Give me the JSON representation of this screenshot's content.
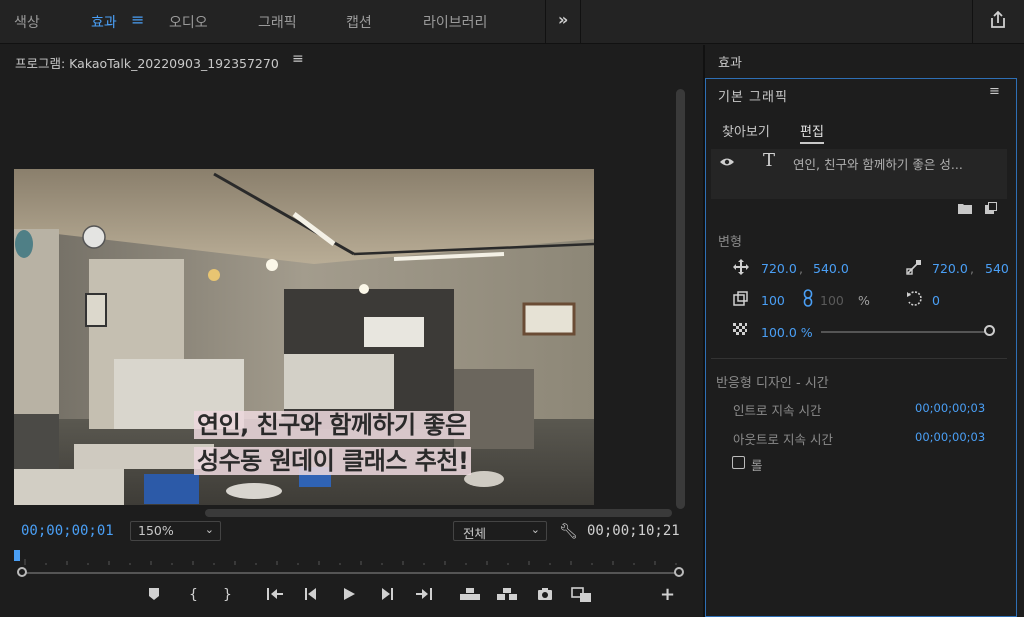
{
  "workspaces": {
    "tabs": [
      {
        "label": "색상",
        "active": false
      },
      {
        "label": "효과",
        "active": true
      },
      {
        "label": "오디오",
        "active": false
      },
      {
        "label": "그래픽",
        "active": false
      },
      {
        "label": "캡션",
        "active": false
      },
      {
        "label": "라이브러리",
        "active": false
      }
    ],
    "menu_glyph": "≡",
    "more_glyph": "»"
  },
  "program": {
    "title": "프로그램: KakaoTalk_20220903_192357270",
    "menu_glyph": "≡",
    "caption_line1": "연인, 친구와 함께하기 좋은",
    "caption_line2": "성수동 원데이 클래스 추천!",
    "timecode_current": "00;00;00;01",
    "zoom": "150%",
    "quality": "전체",
    "timecode_duration": "00;00;10;21",
    "playhead_fraction": 0.0
  },
  "effects_panel": {
    "tab_label": "효과"
  },
  "essential_graphics": {
    "title": "기본 그래픽",
    "menu_glyph": "≡",
    "tabs": {
      "browse": "찾아보기",
      "edit": "편집"
    },
    "layer_name": "연인, 친구와 함께하기 좋은 성...",
    "transform": {
      "label": "변형",
      "position_x": "720.0",
      "position_y": "540.0",
      "anchor_x": "720.0",
      "anchor_y": "540",
      "scale": "100",
      "scale_linked": "100",
      "percent": "%",
      "rotation": "0",
      "opacity": "100.0 %",
      "opacity_value": 100
    },
    "responsive": {
      "label": "반응형 디자인 - 시간",
      "intro_label": "인트로 지속 시간",
      "intro_value": "00;00;00;03",
      "outro_label": "아웃트로 지속 시간",
      "outro_value": "00;00;00;03",
      "roll_label": "롤",
      "roll_checked": false
    }
  },
  "colors": {
    "accent": "#4a9ff5",
    "panel_bg": "#1d1d1d",
    "focus_border": "#2e6fb5"
  }
}
